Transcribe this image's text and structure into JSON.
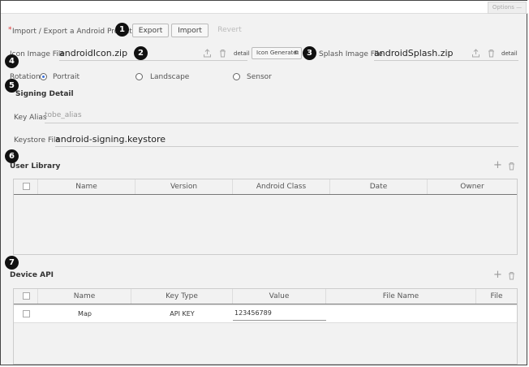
{
  "options_label": "Options —",
  "project": {
    "required_mark": "*",
    "label": "Import / Export a Android Project",
    "export_label": "Export",
    "import_label": "Import",
    "revert_label": "Revert"
  },
  "icon_image": {
    "label": "Icon Image File",
    "value": "androidIcon.zip",
    "detail_label": "detail",
    "generate_label": "Icon Generate"
  },
  "splash_image": {
    "label": "Splash Image File",
    "value": "androidSplash.zip",
    "detail_label": "detail"
  },
  "rotation": {
    "label": "Rotation",
    "options": [
      "Portrait",
      "Landscape",
      "Sensor"
    ],
    "selected": "Portrait"
  },
  "signing": {
    "title": "Signing Detail",
    "key_alias_label": "Key Alias",
    "key_alias_value": "tobe_alias",
    "keystore_label": "Keystore File",
    "keystore_value": "android-signing.keystore"
  },
  "user_library": {
    "title": "User Library",
    "columns": [
      "Name",
      "Version",
      "Android Class",
      "Date",
      "Owner"
    ]
  },
  "device_api": {
    "title": "Device API",
    "columns": [
      "Name",
      "Key Type",
      "Value",
      "File Name",
      "File"
    ],
    "rows": [
      {
        "name": "Map",
        "key_type": "API KEY",
        "value": "123456789",
        "file_name": "",
        "file": ""
      }
    ]
  },
  "badges": [
    "1",
    "2",
    "3",
    "4",
    "5",
    "6",
    "7"
  ],
  "colors": {
    "badge": "#111111",
    "radio_selected": "#3a6fd8",
    "required": "#dd3333"
  }
}
